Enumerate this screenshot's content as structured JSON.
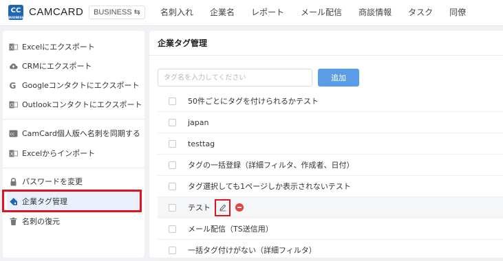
{
  "header": {
    "logo_text": "CC",
    "logo_sub": "BUSINESS",
    "brand": "CAMCARD",
    "edition": "BUSINESS ⇆",
    "nav": [
      "名刺入れ",
      "企業名",
      "レポート",
      "メール配信",
      "商談情報",
      "タスク",
      "同僚"
    ]
  },
  "sidebar": {
    "items": [
      {
        "label": "Excelにエクスポート",
        "icon": "excel-icon"
      },
      {
        "label": "CRMにエクスポート",
        "icon": "cloud-upload-icon"
      },
      {
        "label": "Googleコンタクトにエクスポート",
        "icon": "google-icon"
      },
      {
        "label": "Outlookコンタクトにエクスポート",
        "icon": "outlook-icon"
      },
      {
        "label": "CamCard個人版へ名刺を同期する",
        "icon": "camcard-icon"
      },
      {
        "label": "Excelからインポート",
        "icon": "excel-import-icon"
      },
      {
        "label": "パスワードを変更",
        "icon": "lock-icon"
      },
      {
        "label": "企業タグ管理",
        "icon": "tag-icon"
      },
      {
        "label": "名刺の復元",
        "icon": "trash-icon"
      }
    ]
  },
  "main": {
    "title": "企業タグ管理",
    "input_placeholder": "タグ名を入力してください",
    "add_label": "追加",
    "tags": [
      "50件ごとにタグを付けられるかテスト",
      "japan",
      "testtag",
      "タグの一括登録（詳細フィルタ、作成者、日付）",
      "タグ選択しても1ページしか表示されないテスト",
      "テスト",
      "メール配信（TS送信用）",
      "一括タグ付けがない（詳細フィルタ）"
    ]
  },
  "colors": {
    "accent": "#5b9ce6",
    "highlight_red": "#e0141e",
    "delete_red": "#e8423c",
    "logo_blue": "#1f67b4"
  }
}
